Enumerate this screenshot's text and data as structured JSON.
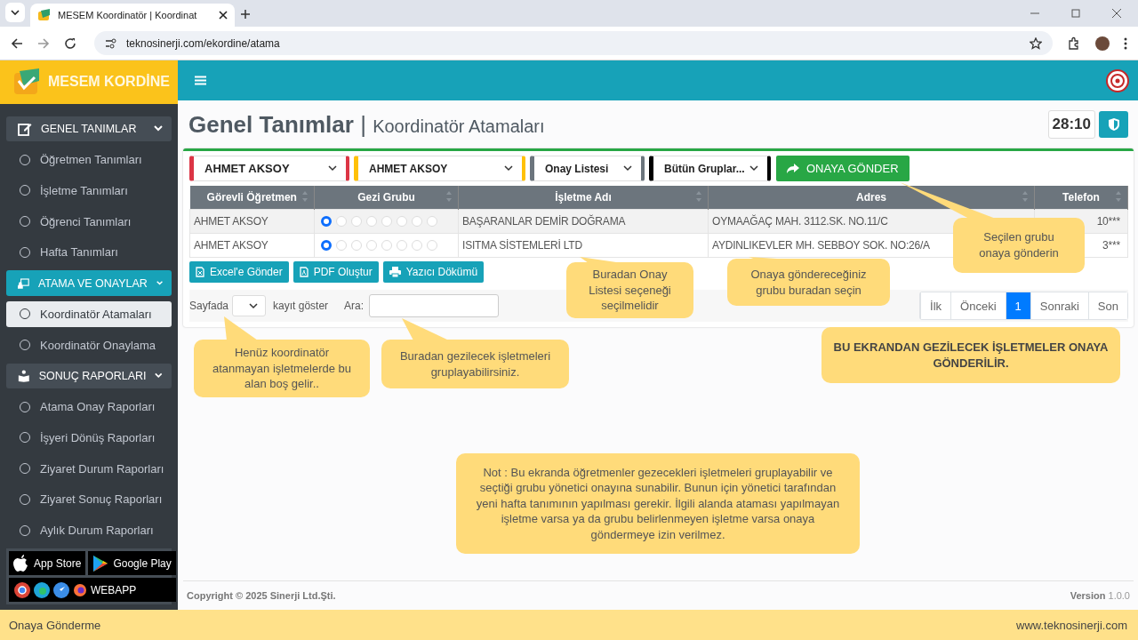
{
  "browser": {
    "tab_title": "MESEM Koordinatör | Koordinat",
    "url": "teknosinerji.com/ekordine/atama"
  },
  "brand": "MESEM KORDİNE",
  "sidebar": [
    {
      "label": "GENEL TANIMLAR",
      "kind": "edit",
      "selected": false,
      "expanded": true,
      "items": [
        {
          "label": "Öğretmen Tanımları",
          "selected": false
        },
        {
          "label": "İşletme Tanımları",
          "selected": false
        },
        {
          "label": "Öğrenci Tanımları",
          "selected": false
        },
        {
          "label": "Hafta Tanımları",
          "selected": false
        }
      ]
    },
    {
      "label": "ATAMA VE ONAYLAR",
      "kind": "board",
      "selected": true,
      "expanded": true,
      "items": [
        {
          "label": "Koordinatör Atamaları",
          "selected": true
        },
        {
          "label": "Koordinatör Onaylama",
          "selected": false
        }
      ]
    },
    {
      "label": "SONUÇ RAPORLARI",
      "kind": "reader",
      "selected": false,
      "expanded": true,
      "items": [
        {
          "label": "Atama Onay Raporları",
          "selected": false
        },
        {
          "label": "İşyeri Dönüş Raporları",
          "selected": false
        },
        {
          "label": "Ziyaret Durum Raporları",
          "selected": false
        },
        {
          "label": "Ziyaret Sonuç Raporları",
          "selected": false
        },
        {
          "label": "Aylık Durum Raporları",
          "selected": false
        }
      ]
    }
  ],
  "stores": [
    {
      "label": "App Store",
      "kind": "apple"
    },
    {
      "label": "Google Play",
      "kind": "play"
    },
    {
      "label": "WEBAPP",
      "kind": "web"
    }
  ],
  "page": {
    "title": "Genel Tanımlar",
    "separator": "|",
    "subtitle": "Koordinatör Atamaları",
    "timer": "28:10"
  },
  "filters": [
    {
      "value": "AHMET AKSOY",
      "color": "#dc3545"
    },
    {
      "value": "AHMET AKSOY",
      "color": "#ffc107"
    },
    {
      "value": "Onay Listesi",
      "color": "#6c757d"
    },
    {
      "value": "Bütün Gruplar...",
      "color": "#000000"
    }
  ],
  "send_button": "ONAYA GÖNDER",
  "table": {
    "columns": [
      "Görevli Öğretmen",
      "Gezi Grubu",
      "İşletme Adı",
      "Adres",
      "Telefon"
    ],
    "rows": [
      {
        "teacher": "AHMET AKSOY",
        "groups": [
          {
            "selected": true
          },
          {
            "selected": false
          },
          {
            "selected": false
          },
          {
            "selected": false
          },
          {
            "selected": false
          },
          {
            "selected": false
          },
          {
            "selected": false
          },
          {
            "selected": false
          }
        ],
        "business": "BAŞARANLAR DEMİR DOĞRAMA",
        "address": "OYMAAĞAÇ MAH. 3112.SK. NO.11/C",
        "phone": "10***"
      },
      {
        "teacher": "AHMET AKSOY",
        "groups": [
          {
            "selected": true
          },
          {
            "selected": false
          },
          {
            "selected": false
          },
          {
            "selected": false
          },
          {
            "selected": false
          },
          {
            "selected": false
          },
          {
            "selected": false
          },
          {
            "selected": false
          }
        ],
        "business": "ISITMA SİSTEMLERİ LTD",
        "address": "AYDINLIKEVLER MH. SEBBOY SOK. NO:26/A",
        "phone": "3***"
      }
    ]
  },
  "exports": [
    {
      "label": "Excel'e Gönder",
      "kind": "excel"
    },
    {
      "label": "PDF Oluştur",
      "kind": "pdf"
    },
    {
      "label": "Yazıcı Dökümü",
      "kind": "print"
    }
  ],
  "length": {
    "before": "Sayfada",
    "after": "kayıt göster"
  },
  "search": {
    "label": "Ara:"
  },
  "pagination": [
    {
      "label": "İlk",
      "selected": false
    },
    {
      "label": "Önceki",
      "selected": false
    },
    {
      "label": "1",
      "selected": true
    },
    {
      "label": "Sonraki",
      "selected": false
    },
    {
      "label": "Son",
      "selected": false
    }
  ],
  "callouts": [
    {
      "text": "Henüz koordinatör atanmayan işletmelerde bu alan boş gelir..",
      "kind": "pointer"
    },
    {
      "text": "Buradan gezilecek işletmeleri gruplayabilirsiniz.",
      "kind": "pointer"
    },
    {
      "text": "Buradan Onay Listesi seçeneği seçilmelidir",
      "kind": "pointer"
    },
    {
      "text": "Onaya göndereceğiniz grubu buradan seçin",
      "kind": "pointer"
    },
    {
      "text": "Seçilen grubu onaya gönderin",
      "kind": "pointer"
    },
    {
      "text": "BU EKRANDAN GEZİLECEK İŞLETMELER ONAYA GÖNDERİLİR.",
      "kind": "banner"
    },
    {
      "text": "Not : Bu ekranda öğretmenler gezecekleri işletmeleri gruplayabilir ve seçtiği grubu yönetici onayına sunabilir. Bunun için yönetici tarafından yeni hafta tanımının yapılması gerekir. İlgili alanda ataması yapılmayan işletme varsa ya da grubu belirlenmeyen işletme varsa onaya göndermeye izin verilmez.",
      "kind": "note"
    }
  ],
  "footer": {
    "copyright": "Copyright © 2025 Sinerji Ltd.Şti.",
    "version_label": "Version",
    "version": "1.0.0"
  },
  "caption": {
    "left": "Onaya Gönderme",
    "right": "www.teknosinerji.com"
  }
}
